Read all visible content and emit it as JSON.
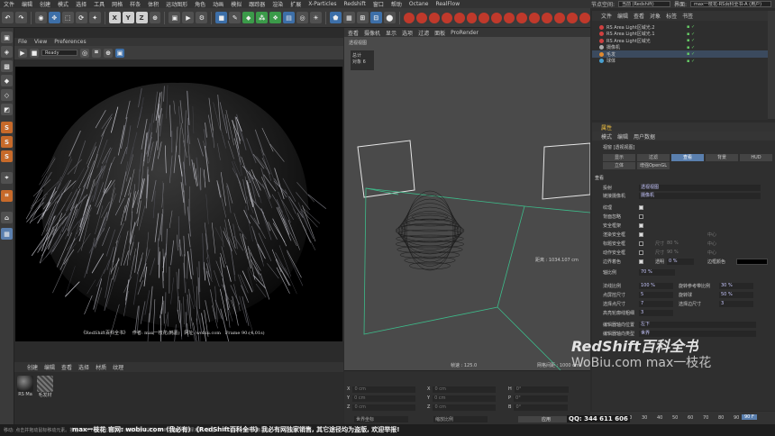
{
  "menubar": {
    "items": [
      "文件",
      "编辑",
      "创建",
      "模式",
      "选择",
      "工具",
      "网格",
      "样条",
      "体积",
      "运动图形",
      "角色",
      "动画",
      "模拟",
      "跟踪器",
      "渲染",
      "扩展",
      "X-Particles",
      "Redshift",
      "窗口",
      "帮助",
      "Octane",
      "RealFlow"
    ],
    "node_space_label": "节点空间:",
    "node_space_value": "当前 (Redshift)",
    "layout_label": "界面:",
    "layout_value": "max一枝花-RS百科全书-A (用户)"
  },
  "toolbar": {
    "axis_x": "X",
    "axis_y": "Y",
    "axis_z": "Z"
  },
  "render_view": {
    "menu": [
      "File",
      "View",
      "Preferences"
    ],
    "status_value": "Ready",
    "caption_title": "《RedShift百科全书》",
    "caption_author": "作者: max一枝花(韩嘉)",
    "caption_site": "网址: wobiu.com",
    "caption_frame": "Frame 90:(4.01s)"
  },
  "material_manager": {
    "menu": [
      "创建",
      "编辑",
      "查看",
      "选择",
      "材质",
      "纹理"
    ],
    "materials": [
      {
        "name": "RS Ma"
      },
      {
        "name": "毛发材"
      }
    ]
  },
  "viewport": {
    "menu": [
      "查看",
      "摄像机",
      "显示",
      "选项",
      "过滤",
      "面板",
      "ProRender"
    ],
    "label": "透视视图",
    "hud_title": "总计",
    "hud_objects_label": "对象",
    "hud_objects_value": "6",
    "distance_label": "距离 : 1034.107 cm",
    "speed_label": "帧速 : 125.0",
    "grid_label": "网格间距 : 1000 cm"
  },
  "coordinates": {
    "x": "X",
    "y": "Y",
    "z": "Z",
    "hx": "X",
    "hy": "Y",
    "hz": "Z",
    "h": "H",
    "p": "P",
    "b": "B",
    "unit": "0 cm",
    "angle": "0°",
    "space_value": "世界坐标",
    "scale_value": "缩放比例",
    "apply_label": "应用"
  },
  "object_manager": {
    "menu": [
      "文件",
      "编辑",
      "查看",
      "对象",
      "标签",
      "书签"
    ],
    "objects": [
      {
        "name": "RS Area Light区域光.2",
        "color": "#d04040"
      },
      {
        "name": "RS Area Light区域光.1",
        "color": "#d04040"
      },
      {
        "name": "RS Area Light区域光",
        "color": "#d04040"
      },
      {
        "name": "摄像机",
        "color": "#aaaaaa"
      },
      {
        "name": "毛发",
        "color": "#e08a30"
      },
      {
        "name": "球体",
        "color": "#49a0d0"
      }
    ]
  },
  "attribute_manager": {
    "header": "属性",
    "menu": [
      "模式",
      "编辑",
      "用户数据"
    ],
    "title": "视窗 [透视视图]",
    "tabs": [
      "显示",
      "过滤",
      "查看",
      "背景",
      "HUD"
    ],
    "tabs2": [
      "立体",
      "增强OpenGL"
    ],
    "section": "查看",
    "projection_label": "投射",
    "projection_value": "透视视图",
    "linked_camera_label": "链接摄像机",
    "linked_camera_value": "摄像机",
    "options": [
      {
        "label": "纹理",
        "checked": true
      },
      {
        "label": "背面忽略",
        "checked": false
      },
      {
        "label": "安全框架",
        "checked": true
      },
      {
        "label": "渲染安全框",
        "checked": true
      },
      {
        "label": "标题安全框",
        "checked": false
      },
      {
        "label": "动作安全框",
        "checked": false
      },
      {
        "label": "边界着色",
        "checked": true
      }
    ],
    "size_label": "尺寸",
    "center_label": "中心",
    "size1": "80 %",
    "size2": "90 %",
    "transparency_label": "透明",
    "transparency_value": "0 %",
    "border_color_label": "边框颜色",
    "axis_scale_label": "轴比例",
    "axis_scale_value": "70 %",
    "fields": [
      {
        "label": "法线比例",
        "value": "100 %",
        "label2": "旋转参考带比例",
        "value2": "30 %"
      },
      {
        "label": "点屏控尺寸",
        "value": "5",
        "label2": "旋转球",
        "value2": "50 %"
      },
      {
        "label": "选择点尺寸",
        "value": "7",
        "label2": "选择边尺寸",
        "value2": "3"
      },
      {
        "label": "高亮轮廓线粗细",
        "value": "3",
        "label2": "",
        "value2": ""
      }
    ],
    "axis_position_label": "编辑器轴向位置",
    "axis_position_value": "左下",
    "axis_type_label": "编辑器轴向类型",
    "axis_type_value": "世界"
  },
  "timeline": {
    "frames": [
      "0",
      "10",
      "20",
      "30",
      "40",
      "50",
      "60",
      "70",
      "80",
      "90"
    ],
    "current": "90 F"
  },
  "status": {
    "text": "移动: 点击并拖动鼠标移动元素。按住 SHIFT 键量化移动; 节点编辑器中按住 SHIFT 键增加选择对象; 按住 CTRL 键减少选择对象。"
  },
  "watermark": {
    "line1": "RedShift百科全书",
    "line2": "WoBiu.com max一枝花",
    "footer": "max一枝花 官网: wobiu.com (我必有) 《RedShift百科全书》我必有网独家销售, 其它途径均为盗版, 欢迎举报!",
    "qq": "QQ: 344 611 606"
  }
}
